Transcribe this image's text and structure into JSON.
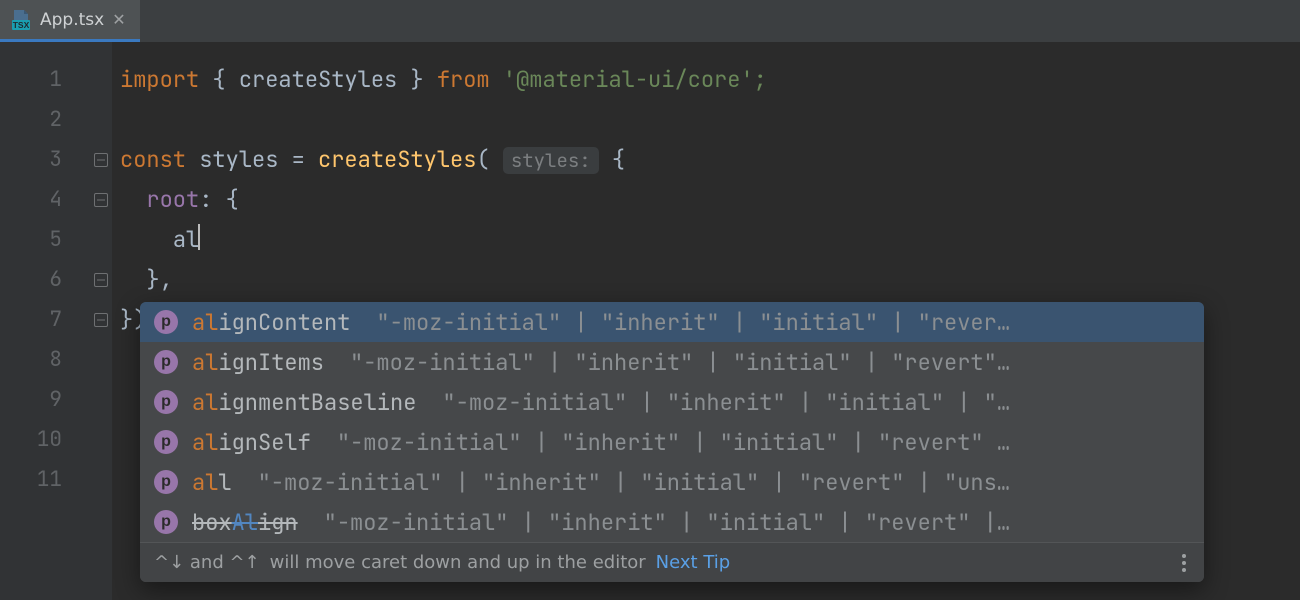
{
  "tab": {
    "filename": "App.tsx",
    "icon_label": "TSX"
  },
  "gutter": {
    "lines": [
      "1",
      "2",
      "3",
      "4",
      "5",
      "6",
      "7",
      "8",
      "9",
      "10",
      "11"
    ]
  },
  "code": {
    "kw_import": "import",
    "brace_l": " { ",
    "import_name": "createStyles",
    "brace_r": " } ",
    "kw_from": "from",
    "import_path_q": " '",
    "import_path": "@material-ui/core",
    "import_path_q2": "';",
    "kw_const": "const",
    "sp": " ",
    "var_styles": "styles",
    "eq": " = ",
    "fn_create": "createStyles",
    "paren": "( ",
    "hint_styles": "styles:",
    "obj_open": " {",
    "field_root": "root",
    "colon_brace": ": {",
    "typed": "al",
    "close_comma": "},",
    "close_paren": "});"
  },
  "popup": {
    "items": [
      {
        "pre": "al",
        "match": "",
        "post": "ignContent",
        "type": "\"-moz-initial\" | \"inherit\" | \"initial\" | \"rever…",
        "selected": true,
        "deprecated": false,
        "matchStyle": "prefix"
      },
      {
        "pre": "al",
        "match": "",
        "post": "ignItems",
        "type": "\"-moz-initial\" | \"inherit\" | \"initial\" | \"revert\"…",
        "selected": false,
        "deprecated": false,
        "matchStyle": "prefix"
      },
      {
        "pre": "al",
        "match": "",
        "post": "ignmentBaseline",
        "type": "\"-moz-initial\" | \"inherit\" | \"initial\" | \"…",
        "selected": false,
        "deprecated": false,
        "matchStyle": "prefix"
      },
      {
        "pre": "al",
        "match": "",
        "post": "ignSelf",
        "type": "\"-moz-initial\" | \"inherit\" | \"initial\" | \"revert\" …",
        "selected": false,
        "deprecated": false,
        "matchStyle": "prefix"
      },
      {
        "pre": "al",
        "match": "",
        "post": "l",
        "type": "\"-moz-initial\" | \"inherit\" | \"initial\" | \"revert\" | \"uns…",
        "selected": false,
        "deprecated": false,
        "matchStyle": "prefix"
      },
      {
        "pre": "box",
        "match": "Al",
        "post": "ign",
        "type": "\"-moz-initial\" | \"inherit\" | \"initial\" | \"revert\" |…",
        "selected": false,
        "deprecated": true,
        "matchStyle": "mid"
      }
    ],
    "footer_keys": "^↓ and ^↑ ",
    "footer_text": "will move caret down and up in the editor",
    "footer_link": "Next Tip"
  }
}
